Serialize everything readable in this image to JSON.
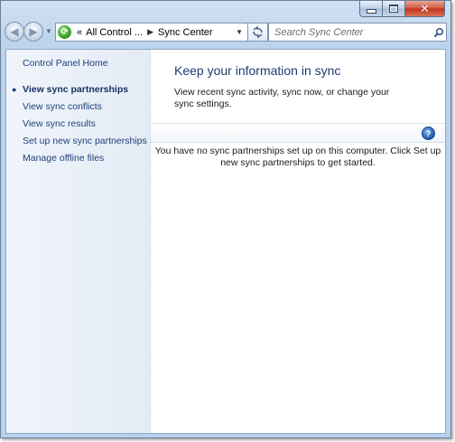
{
  "window": {
    "caption_buttons": {
      "minimize": "minimize",
      "maximize": "maximize",
      "close": "close"
    }
  },
  "navbar": {
    "breadcrumbs": [
      "All Control ...",
      "Sync Center"
    ],
    "search_placeholder": "Search Sync Center"
  },
  "sidebar": {
    "home": "Control Panel Home",
    "items": [
      {
        "label": "View sync partnerships",
        "selected": true
      },
      {
        "label": "View sync conflicts",
        "selected": false
      },
      {
        "label": "View sync results",
        "selected": false
      },
      {
        "label": "Set up new sync partnerships",
        "selected": false
      },
      {
        "label": "Manage offline files",
        "selected": false
      }
    ]
  },
  "main": {
    "title": "Keep your information in sync",
    "description": "View recent sync activity, sync now, or change your sync settings.",
    "empty_message": "You have no sync partnerships set up on this computer. Click Set up new sync partnerships to get started."
  },
  "icons": {
    "back": "back-arrow-icon",
    "forward": "forward-arrow-icon",
    "address": "sync-center-icon",
    "refresh": "refresh-icon",
    "search": "search-icon",
    "help": "help-icon"
  },
  "colors": {
    "link": "#1e3f7a",
    "title": "#1e3d6f",
    "frame": "#b9d1ea",
    "close": "#c2301a"
  }
}
